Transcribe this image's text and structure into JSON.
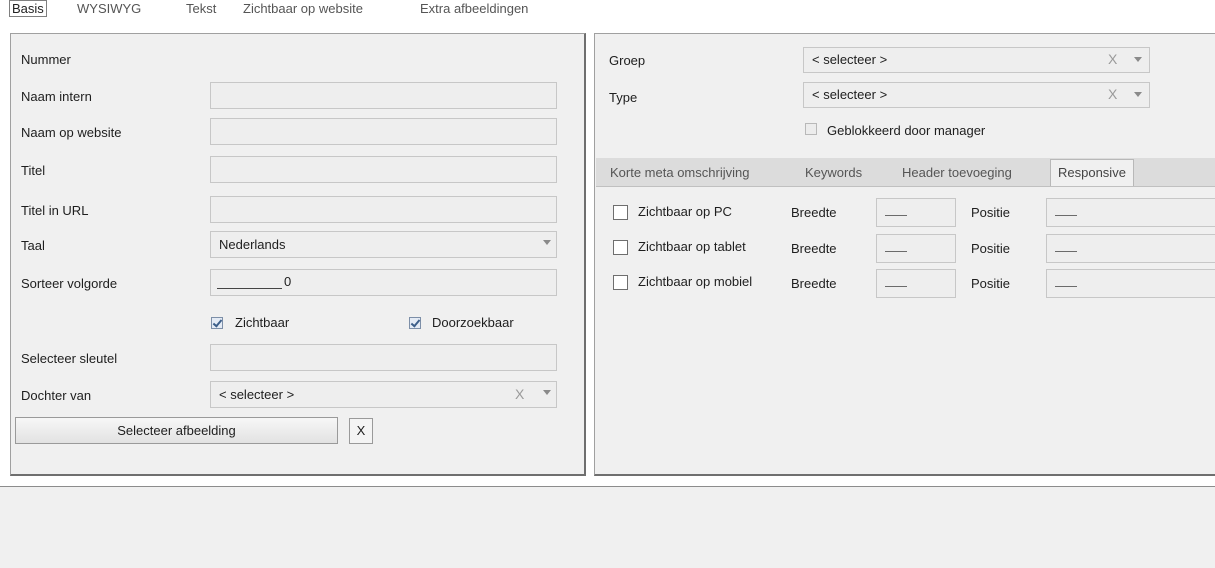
{
  "top_tabs": [
    "Basis",
    "WYSIWYG",
    "Tekst",
    "Zichtbaar op website",
    "Extra afbeeldingen"
  ],
  "left": {
    "labels": {
      "nummer": "Nummer",
      "naam_intern": "Naam intern",
      "naam_op_website": "Naam op website",
      "titel": "Titel",
      "titel_in_url": "Titel in URL",
      "taal": "Taal",
      "sorteer_volgorde": "Sorteer volgorde",
      "selecteer_sleutel": "Selecteer sleutel",
      "dochter_van": "Dochter van"
    },
    "fields": {
      "naam_intern": "",
      "naam_op_website": "",
      "titel": "",
      "titel_in_url": "",
      "taal": "Nederlands",
      "sorteer_volgorde": "0",
      "selecteer_sleutel": "",
      "dochter_van": "< selecteer >"
    },
    "checkboxes": {
      "zichtbaar": {
        "label": "Zichtbaar",
        "checked": true
      },
      "doorzoekbaar": {
        "label": "Doorzoekbaar",
        "checked": true
      }
    },
    "select_image_button": "Selecteer afbeelding",
    "clear_image_button": "X",
    "dropdown_clear": "X"
  },
  "right": {
    "labels": {
      "groep": "Groep",
      "type": "Type"
    },
    "groep_value": "< selecteer >",
    "type_value": "< selecteer >",
    "dropdown_clear": "X",
    "geblokkeerd": {
      "label": "Geblokkeerd door manager",
      "checked": false
    },
    "sub_tabs": [
      "Korte meta omschrijving",
      "Keywords",
      "Header toevoeging",
      "Responsive"
    ],
    "active_sub_tab": "Responsive",
    "responsive_rows": [
      {
        "label": "Zichtbaar op PC",
        "checked": false,
        "breedte_label": "Breedte",
        "positie_label": "Positie"
      },
      {
        "label": "Zichtbaar op tablet",
        "checked": false,
        "breedte_label": "Breedte",
        "positie_label": "Positie"
      },
      {
        "label": "Zichtbaar op mobiel",
        "checked": false,
        "breedte_label": "Breedte",
        "positie_label": "Positie"
      }
    ]
  }
}
